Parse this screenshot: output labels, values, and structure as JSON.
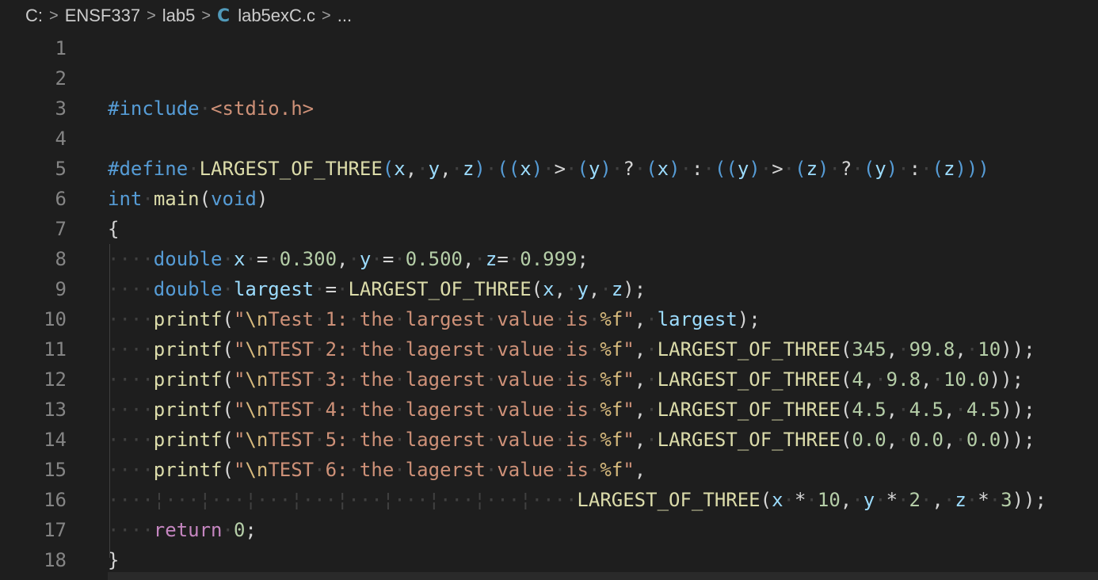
{
  "breadcrumb": {
    "items": [
      "C:",
      "ENSF337",
      "lab5",
      "lab5exC.c",
      "..."
    ],
    "file_icon": "C"
  },
  "editor": {
    "line_numbers": [
      "1",
      "2",
      "3",
      "4",
      "5",
      "6",
      "7",
      "8",
      "9",
      "10",
      "11",
      "12",
      "13",
      "14",
      "15",
      "16",
      "17",
      "18"
    ],
    "lines": [
      [],
      [],
      [
        [
          "pp",
          "#include"
        ],
        [
          "ws",
          "·"
        ],
        [
          "str",
          "<stdio.h>"
        ]
      ],
      [],
      [
        [
          "pp",
          "#define"
        ],
        [
          "ws",
          "·"
        ],
        [
          "mac",
          "LARGEST_OF_THREE"
        ],
        [
          "par",
          "("
        ],
        [
          "var",
          "x"
        ],
        [
          "pun",
          ","
        ],
        [
          "ws",
          "·"
        ],
        [
          "var",
          "y"
        ],
        [
          "pun",
          ","
        ],
        [
          "ws",
          "·"
        ],
        [
          "var",
          "z"
        ],
        [
          "par",
          ")"
        ],
        [
          "ws",
          "·"
        ],
        [
          "par",
          "(("
        ],
        [
          "var",
          "x"
        ],
        [
          "par",
          ")"
        ],
        [
          "ws",
          "·"
        ],
        [
          "pun",
          ">"
        ],
        [
          "ws",
          "·"
        ],
        [
          "par",
          "("
        ],
        [
          "var",
          "y"
        ],
        [
          "par",
          ")"
        ],
        [
          "ws",
          "·"
        ],
        [
          "pun",
          "?"
        ],
        [
          "ws",
          "·"
        ],
        [
          "par",
          "("
        ],
        [
          "var",
          "x"
        ],
        [
          "par",
          ")"
        ],
        [
          "ws",
          "·"
        ],
        [
          "pun",
          ":"
        ],
        [
          "ws",
          "·"
        ],
        [
          "par",
          "(("
        ],
        [
          "var",
          "y"
        ],
        [
          "par",
          ")"
        ],
        [
          "ws",
          "·"
        ],
        [
          "pun",
          ">"
        ],
        [
          "ws",
          "·"
        ],
        [
          "par",
          "("
        ],
        [
          "var",
          "z"
        ],
        [
          "par",
          ")"
        ],
        [
          "ws",
          "·"
        ],
        [
          "pun",
          "?"
        ],
        [
          "ws",
          "·"
        ],
        [
          "par",
          "("
        ],
        [
          "var",
          "y"
        ],
        [
          "par",
          ")"
        ],
        [
          "ws",
          "·"
        ],
        [
          "pun",
          ":"
        ],
        [
          "ws",
          "·"
        ],
        [
          "par",
          "("
        ],
        [
          "var",
          "z"
        ],
        [
          "par",
          ")))"
        ]
      ],
      [
        [
          "kw",
          "int"
        ],
        [
          "ws",
          "·"
        ],
        [
          "fn",
          "main"
        ],
        [
          "pun",
          "("
        ],
        [
          "kw",
          "void"
        ],
        [
          "pun",
          ")"
        ]
      ],
      [
        [
          "pun",
          "{"
        ]
      ],
      [
        [
          "ws",
          "····"
        ],
        [
          "kw",
          "double"
        ],
        [
          "ws",
          "·"
        ],
        [
          "var",
          "x"
        ],
        [
          "ws",
          "·"
        ],
        [
          "pun",
          "="
        ],
        [
          "ws",
          "·"
        ],
        [
          "num",
          "0.300"
        ],
        [
          "pun",
          ","
        ],
        [
          "ws",
          "·"
        ],
        [
          "var",
          "y"
        ],
        [
          "ws",
          "·"
        ],
        [
          "pun",
          "="
        ],
        [
          "ws",
          "·"
        ],
        [
          "num",
          "0.500"
        ],
        [
          "pun",
          ","
        ],
        [
          "ws",
          "·"
        ],
        [
          "var",
          "z"
        ],
        [
          "pun",
          "="
        ],
        [
          "ws",
          "·"
        ],
        [
          "num",
          "0.999"
        ],
        [
          "pun",
          ";"
        ]
      ],
      [
        [
          "ws",
          "····"
        ],
        [
          "kw",
          "double"
        ],
        [
          "ws",
          "·"
        ],
        [
          "var",
          "largest"
        ],
        [
          "ws",
          "·"
        ],
        [
          "pun",
          "="
        ],
        [
          "ws",
          "·"
        ],
        [
          "mac",
          "LARGEST_OF_THREE"
        ],
        [
          "pun",
          "("
        ],
        [
          "var",
          "x"
        ],
        [
          "pun",
          ","
        ],
        [
          "ws",
          "·"
        ],
        [
          "var",
          "y"
        ],
        [
          "pun",
          ","
        ],
        [
          "ws",
          "·"
        ],
        [
          "var",
          "z"
        ],
        [
          "pun",
          ");"
        ]
      ],
      [
        [
          "ws",
          "····"
        ],
        [
          "fn",
          "printf"
        ],
        [
          "pun",
          "("
        ],
        [
          "str",
          "\""
        ],
        [
          "esc",
          "\\n"
        ],
        [
          "str",
          "Test"
        ],
        [
          "ws",
          "·"
        ],
        [
          "str",
          "1:"
        ],
        [
          "ws",
          "·"
        ],
        [
          "str",
          "the"
        ],
        [
          "ws",
          "·"
        ],
        [
          "str",
          "largest"
        ],
        [
          "ws",
          "·"
        ],
        [
          "str",
          "value"
        ],
        [
          "ws",
          "·"
        ],
        [
          "str",
          "is"
        ],
        [
          "ws",
          "·"
        ],
        [
          "esc",
          "%f"
        ],
        [
          "str",
          "\""
        ],
        [
          "pun",
          ","
        ],
        [
          "ws",
          "·"
        ],
        [
          "var",
          "largest"
        ],
        [
          "pun",
          ");"
        ]
      ],
      [
        [
          "ws",
          "····"
        ],
        [
          "fn",
          "printf"
        ],
        [
          "pun",
          "("
        ],
        [
          "str",
          "\""
        ],
        [
          "esc",
          "\\n"
        ],
        [
          "str",
          "TEST"
        ],
        [
          "ws",
          "·"
        ],
        [
          "str",
          "2:"
        ],
        [
          "ws",
          "·"
        ],
        [
          "str",
          "the"
        ],
        [
          "ws",
          "·"
        ],
        [
          "str",
          "lagerst"
        ],
        [
          "ws",
          "·"
        ],
        [
          "str",
          "value"
        ],
        [
          "ws",
          "·"
        ],
        [
          "str",
          "is"
        ],
        [
          "ws",
          "·"
        ],
        [
          "esc",
          "%f"
        ],
        [
          "str",
          "\""
        ],
        [
          "pun",
          ","
        ],
        [
          "ws",
          "·"
        ],
        [
          "mac",
          "LARGEST_OF_THREE"
        ],
        [
          "pun",
          "("
        ],
        [
          "num",
          "345"
        ],
        [
          "pun",
          ","
        ],
        [
          "ws",
          "·"
        ],
        [
          "num",
          "99.8"
        ],
        [
          "pun",
          ","
        ],
        [
          "ws",
          "·"
        ],
        [
          "num",
          "10"
        ],
        [
          "pun",
          "));"
        ]
      ],
      [
        [
          "ws",
          "····"
        ],
        [
          "fn",
          "printf"
        ],
        [
          "pun",
          "("
        ],
        [
          "str",
          "\""
        ],
        [
          "esc",
          "\\n"
        ],
        [
          "str",
          "TEST"
        ],
        [
          "ws",
          "·"
        ],
        [
          "str",
          "3:"
        ],
        [
          "ws",
          "·"
        ],
        [
          "str",
          "the"
        ],
        [
          "ws",
          "·"
        ],
        [
          "str",
          "lagerst"
        ],
        [
          "ws",
          "·"
        ],
        [
          "str",
          "value"
        ],
        [
          "ws",
          "·"
        ],
        [
          "str",
          "is"
        ],
        [
          "ws",
          "·"
        ],
        [
          "esc",
          "%f"
        ],
        [
          "str",
          "\""
        ],
        [
          "pun",
          ","
        ],
        [
          "ws",
          "·"
        ],
        [
          "mac",
          "LARGEST_OF_THREE"
        ],
        [
          "pun",
          "("
        ],
        [
          "num",
          "4"
        ],
        [
          "pun",
          ","
        ],
        [
          "ws",
          "·"
        ],
        [
          "num",
          "9.8"
        ],
        [
          "pun",
          ","
        ],
        [
          "ws",
          "·"
        ],
        [
          "num",
          "10.0"
        ],
        [
          "pun",
          "));"
        ]
      ],
      [
        [
          "ws",
          "····"
        ],
        [
          "fn",
          "printf"
        ],
        [
          "pun",
          "("
        ],
        [
          "str",
          "\""
        ],
        [
          "esc",
          "\\n"
        ],
        [
          "str",
          "TEST"
        ],
        [
          "ws",
          "·"
        ],
        [
          "str",
          "4:"
        ],
        [
          "ws",
          "·"
        ],
        [
          "str",
          "the"
        ],
        [
          "ws",
          "·"
        ],
        [
          "str",
          "lagerst"
        ],
        [
          "ws",
          "·"
        ],
        [
          "str",
          "value"
        ],
        [
          "ws",
          "·"
        ],
        [
          "str",
          "is"
        ],
        [
          "ws",
          "·"
        ],
        [
          "esc",
          "%f"
        ],
        [
          "str",
          "\""
        ],
        [
          "pun",
          ","
        ],
        [
          "ws",
          "·"
        ],
        [
          "mac",
          "LARGEST_OF_THREE"
        ],
        [
          "pun",
          "("
        ],
        [
          "num",
          "4.5"
        ],
        [
          "pun",
          ","
        ],
        [
          "ws",
          "·"
        ],
        [
          "num",
          "4.5"
        ],
        [
          "pun",
          ","
        ],
        [
          "ws",
          "·"
        ],
        [
          "num",
          "4.5"
        ],
        [
          "pun",
          "));"
        ]
      ],
      [
        [
          "ws",
          "····"
        ],
        [
          "fn",
          "printf"
        ],
        [
          "pun",
          "("
        ],
        [
          "str",
          "\""
        ],
        [
          "esc",
          "\\n"
        ],
        [
          "str",
          "TEST"
        ],
        [
          "ws",
          "·"
        ],
        [
          "str",
          "5:"
        ],
        [
          "ws",
          "·"
        ],
        [
          "str",
          "the"
        ],
        [
          "ws",
          "·"
        ],
        [
          "str",
          "lagerst"
        ],
        [
          "ws",
          "·"
        ],
        [
          "str",
          "value"
        ],
        [
          "ws",
          "·"
        ],
        [
          "str",
          "is"
        ],
        [
          "ws",
          "·"
        ],
        [
          "esc",
          "%f"
        ],
        [
          "str",
          "\""
        ],
        [
          "pun",
          ","
        ],
        [
          "ws",
          "·"
        ],
        [
          "mac",
          "LARGEST_OF_THREE"
        ],
        [
          "pun",
          "("
        ],
        [
          "num",
          "0.0"
        ],
        [
          "pun",
          ","
        ],
        [
          "ws",
          "·"
        ],
        [
          "num",
          "0.0"
        ],
        [
          "pun",
          ","
        ],
        [
          "ws",
          "·"
        ],
        [
          "num",
          "0.0"
        ],
        [
          "pun",
          "));"
        ]
      ],
      [
        [
          "ws",
          "····"
        ],
        [
          "fn",
          "printf"
        ],
        [
          "pun",
          "("
        ],
        [
          "str",
          "\""
        ],
        [
          "esc",
          "\\n"
        ],
        [
          "str",
          "TEST"
        ],
        [
          "ws",
          "·"
        ],
        [
          "str",
          "6:"
        ],
        [
          "ws",
          "·"
        ],
        [
          "str",
          "the"
        ],
        [
          "ws",
          "·"
        ],
        [
          "str",
          "lagerst"
        ],
        [
          "ws",
          "·"
        ],
        [
          "str",
          "value"
        ],
        [
          "ws",
          "·"
        ],
        [
          "str",
          "is"
        ],
        [
          "ws",
          "·"
        ],
        [
          "esc",
          "%f"
        ],
        [
          "str",
          "\""
        ],
        [
          "pun",
          ","
        ]
      ],
      [
        [
          "ws",
          "····¦···¦···¦···¦···¦···¦···¦···¦···¦····"
        ],
        [
          "mac",
          "LARGEST_OF_THREE"
        ],
        [
          "pun",
          "("
        ],
        [
          "var",
          "x"
        ],
        [
          "ws",
          "·"
        ],
        [
          "pun",
          "*"
        ],
        [
          "ws",
          "·"
        ],
        [
          "num",
          "10"
        ],
        [
          "pun",
          ","
        ],
        [
          "ws",
          "·"
        ],
        [
          "var",
          "y"
        ],
        [
          "ws",
          "·"
        ],
        [
          "pun",
          "*"
        ],
        [
          "ws",
          "·"
        ],
        [
          "num",
          "2"
        ],
        [
          "ws",
          "·"
        ],
        [
          "pun",
          ","
        ],
        [
          "ws",
          "·"
        ],
        [
          "var",
          "z"
        ],
        [
          "ws",
          "·"
        ],
        [
          "pun",
          "*"
        ],
        [
          "ws",
          "·"
        ],
        [
          "num",
          "3"
        ],
        [
          "pun",
          "));"
        ]
      ],
      [
        [
          "ws",
          "····"
        ],
        [
          "ctl",
          "return"
        ],
        [
          "ws",
          "·"
        ],
        [
          "num",
          "0"
        ],
        [
          "pun",
          ";"
        ]
      ],
      [
        [
          "pun",
          "}"
        ]
      ]
    ]
  },
  "colors": {
    "background": "#1e1e1e",
    "line_number": "#858585",
    "keyword": "#569cd6",
    "function": "#dcdcaa",
    "variable": "#9cdcfe",
    "number": "#b5cea8",
    "string": "#ce9178",
    "control": "#c586c0"
  }
}
